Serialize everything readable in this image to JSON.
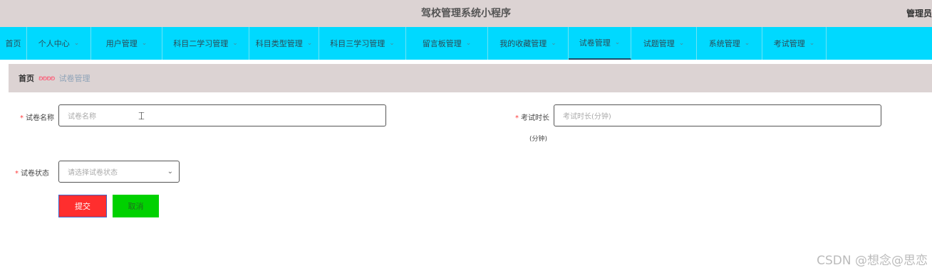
{
  "header": {
    "title": "驾校管理系统小程序",
    "user": "管理员"
  },
  "nav": {
    "items": [
      {
        "label": "首页",
        "has_chevron": false
      },
      {
        "label": "个人中心",
        "has_chevron": true
      },
      {
        "label": "用户管理",
        "has_chevron": true
      },
      {
        "label": "科目二学习管理",
        "has_chevron": true
      },
      {
        "label": "科目类型管理",
        "has_chevron": true
      },
      {
        "label": "科目三学习管理",
        "has_chevron": true
      },
      {
        "label": "留言板管理",
        "has_chevron": true
      },
      {
        "label": "我的收藏管理",
        "has_chevron": true
      },
      {
        "label": "试卷管理",
        "has_chevron": true,
        "active": true
      },
      {
        "label": "试题管理",
        "has_chevron": true
      },
      {
        "label": "系统管理",
        "has_chevron": true
      },
      {
        "label": "考试管理",
        "has_chevron": true
      }
    ],
    "chevron": "⌄"
  },
  "breadcrumb": {
    "home": "首页",
    "separator": "ʚʚʚʚ",
    "current": "试卷管理"
  },
  "form": {
    "paper_name": {
      "label": "试卷名称",
      "placeholder": "试卷名称"
    },
    "duration": {
      "label": "考试时长",
      "sub_label": "(分钟)",
      "placeholder": "考试时长(分钟)"
    },
    "status": {
      "label": "试卷状态",
      "placeholder": "请选择试卷状态"
    },
    "required_mark": "*",
    "submit_label": "提交",
    "cancel_label": "取消"
  },
  "watermark": "CSDN @想念@思恋",
  "colors": {
    "nav_bg": "#00d9ff",
    "header_bg": "#dcd3d3",
    "submit": "#ff2e2e",
    "cancel": "#00d100"
  }
}
